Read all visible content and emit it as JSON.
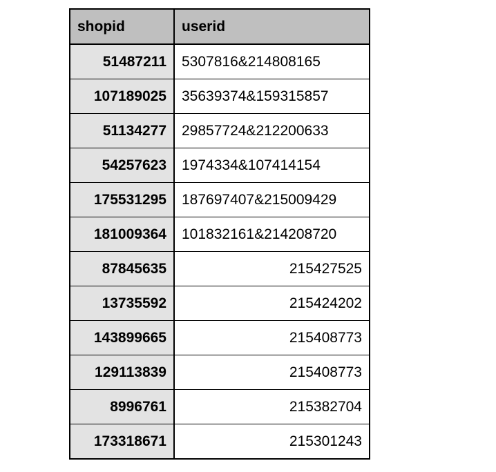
{
  "table": {
    "columns": [
      {
        "key": "shopid",
        "label": "shopid"
      },
      {
        "key": "userid",
        "label": "userid"
      }
    ],
    "rows": [
      {
        "shopid": "51487211",
        "userid": "5307816&214808165",
        "numeric": false
      },
      {
        "shopid": "107189025",
        "userid": "35639374&159315857",
        "numeric": false
      },
      {
        "shopid": "51134277",
        "userid": "29857724&212200633",
        "numeric": false
      },
      {
        "shopid": "54257623",
        "userid": "1974334&107414154",
        "numeric": false
      },
      {
        "shopid": "175531295",
        "userid": "187697407&215009429",
        "numeric": false
      },
      {
        "shopid": "181009364",
        "userid": "101832161&214208720",
        "numeric": false
      },
      {
        "shopid": "87845635",
        "userid": "215427525",
        "numeric": true
      },
      {
        "shopid": "13735592",
        "userid": "215424202",
        "numeric": true
      },
      {
        "shopid": "143899665",
        "userid": "215408773",
        "numeric": true
      },
      {
        "shopid": "129113839",
        "userid": "215408773",
        "numeric": true
      },
      {
        "shopid": "8996761",
        "userid": "215382704",
        "numeric": true
      },
      {
        "shopid": "173318671",
        "userid": "215301243",
        "numeric": true
      }
    ]
  }
}
